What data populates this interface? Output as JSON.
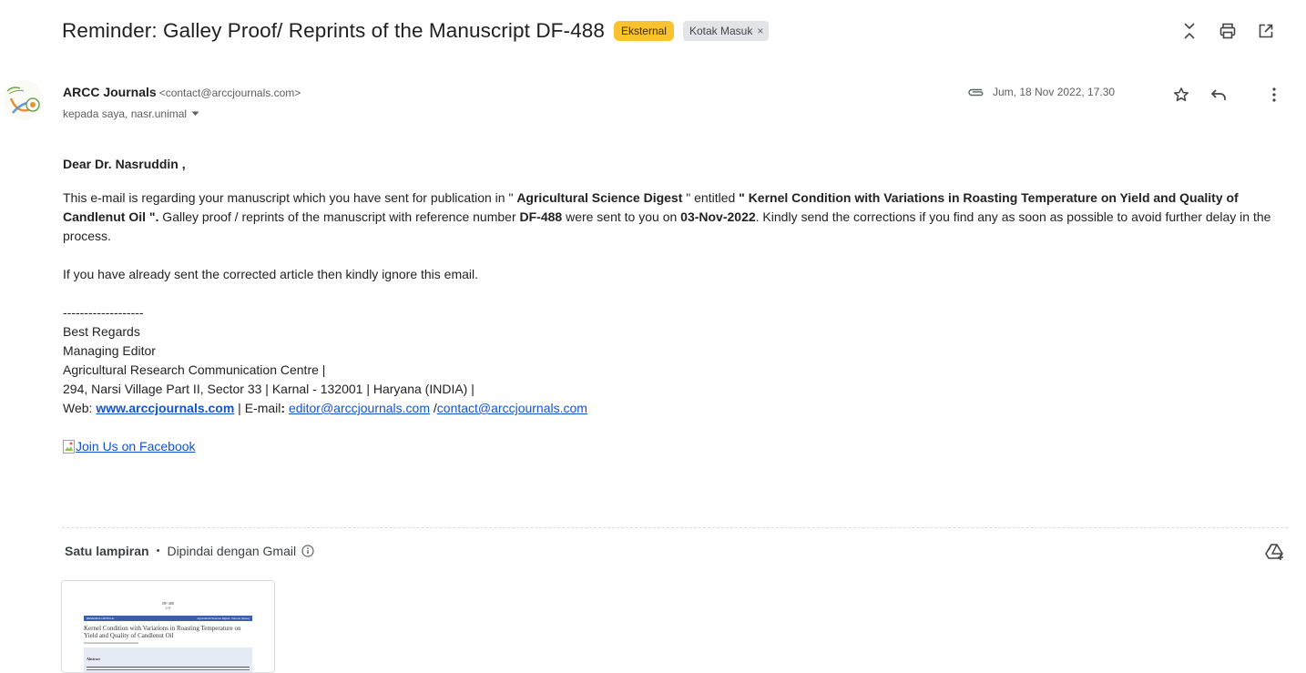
{
  "subject": {
    "title": "Reminder: Galley Proof/ Reprints of the Manuscript DF-488",
    "badge_external": "Eksternal",
    "badge_inbox": "Kotak Masuk",
    "badge_inbox_close": "×"
  },
  "toolbar": {
    "icons": [
      "collapse-all-icon",
      "print-icon",
      "open-new-window-icon"
    ]
  },
  "sender": {
    "name": "ARCC Journals",
    "email": "<contact@arccjournals.com>",
    "recipients": "kepada saya, nasr.unimal",
    "date": "Jum, 18 Nov 2022, 17.30"
  },
  "body": {
    "greeting": "Dear Dr. Nasruddin ,",
    "p1_a": "This e-mail is regarding your manuscript which you have sent for publication in \" ",
    "p1_journal": "Agricultural Science Digest",
    "p1_b": " \" entitled ",
    "p1_title": "\" Kernel Condition with Variations in Roasting Temperature on Yield and Quality of Candlenut Oil \".",
    "p1_c": " Galley proof / reprints of the manuscript with reference number ",
    "p1_ref": "DF-488",
    "p1_d": " were sent to you on ",
    "p1_date": "03-Nov-2022",
    "p1_e": ". Kindly send the corrections if you find any as soon as possible to avoid further delay in the process.",
    "p2": "If you have already sent the corrected article then kindly ignore this email.",
    "sig_divider": "-------------------",
    "sig_regards": "Best Regards",
    "sig_role": "Managing Editor",
    "sig_org": "Agricultural Research Communication Centre |",
    "sig_address": "294, Narsi Village Part II, Sector 33 | Karnal - 132001 | Haryana (INDIA) |",
    "sig_web_label": "Web: ",
    "sig_web_link": "www.arccjournals.com",
    "sig_email_label": " | E-mail",
    "sig_email_colon": ": ",
    "sig_email1": "editor@arccjournals.com",
    "sig_sep": " /",
    "sig_email2": "contact@arccjournals.com",
    "facebook_link": "Join Us on Facebook"
  },
  "attachments": {
    "title": "Satu lampiran",
    "dot": "•",
    "scanned": "Dipindai dengan Gmail",
    "thumb_header": "DF-488\n1-5",
    "thumb_band_left": "RESEARCH ARTICLE",
    "thumb_band_right": "Agricultural Science Digest, Volume (Issue)",
    "thumb_title": "Kernel Condition with Variations in Roasting Temperature on Yield and Quality of Candlenut Oil",
    "thumb_abstract": "Abstract"
  },
  "colors": {
    "badge_external": "#f9c22e",
    "badge_inbox": "#e2e4e7",
    "link": "#1155cc"
  }
}
